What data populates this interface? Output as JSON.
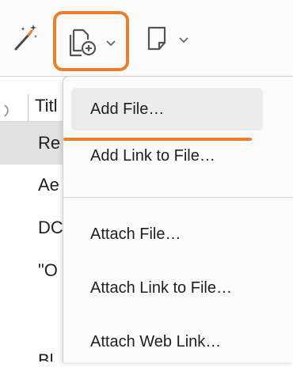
{
  "toolbar": {
    "icons": [
      "magic-wand-icon",
      "add-file-icon",
      "chevron-down-icon",
      "note-icon",
      "chevron-down-icon"
    ],
    "accent_color": "#ee7d2b"
  },
  "list": {
    "header": "Titl",
    "rows": [
      "Re",
      "Ae",
      "DC",
      "\"O",
      "Bl"
    ]
  },
  "menu": {
    "items": [
      {
        "label": "Add File…"
      },
      {
        "label": "Add Link to File…"
      },
      {
        "label": "Attach File…"
      },
      {
        "label": "Attach Link to File…"
      },
      {
        "label": "Attach Web Link…"
      }
    ]
  }
}
